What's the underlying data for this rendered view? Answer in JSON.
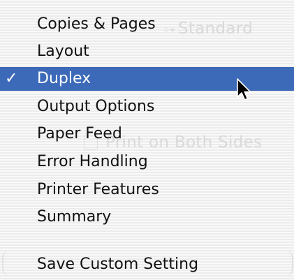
{
  "menu": {
    "items": [
      {
        "label": "Copies & Pages"
      },
      {
        "label": "Layout"
      },
      {
        "label": "Duplex",
        "selected": true
      },
      {
        "label": "Output Options"
      },
      {
        "label": "Paper Feed"
      },
      {
        "label": "Error Handling"
      },
      {
        "label": "Printer Features"
      },
      {
        "label": "Summary"
      }
    ],
    "check_mark": "✓",
    "save_item": {
      "label": "Save Custom Setting"
    }
  },
  "background": {
    "presets_value": "Standard",
    "print_both_sides_label": "Print on Both Sides"
  },
  "colors": {
    "selection": "#3c69b8",
    "text": "#111111",
    "selected_text": "#ffffff"
  },
  "icons": {
    "check": "check-icon",
    "cursor": "mouse-pointer-icon"
  }
}
